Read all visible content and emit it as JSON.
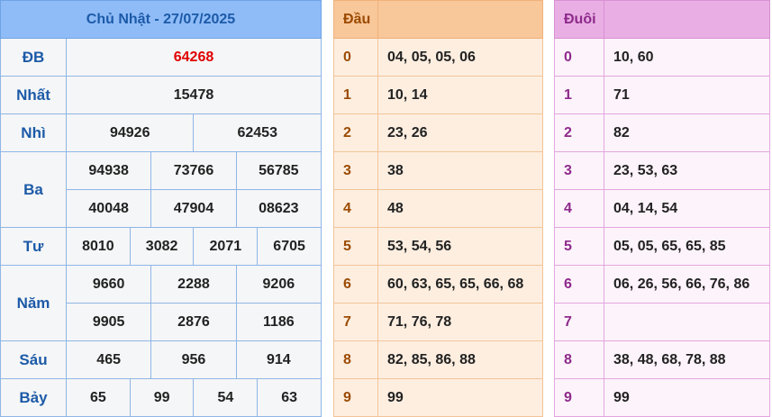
{
  "results": {
    "header": "Chủ Nhật - 27/07/2025",
    "db": {
      "label": "ĐB",
      "value": "64268"
    },
    "nhat": {
      "label": "Nhất",
      "value": "15478"
    },
    "nhi": {
      "label": "Nhì",
      "values": [
        "94926",
        "62453"
      ]
    },
    "ba": {
      "label": "Ba",
      "row1": [
        "94938",
        "73766",
        "56785"
      ],
      "row2": [
        "40048",
        "47904",
        "08623"
      ]
    },
    "tu": {
      "label": "Tư",
      "values": [
        "8010",
        "3082",
        "2071",
        "6705"
      ]
    },
    "nam": {
      "label": "Năm",
      "row1": [
        "9660",
        "2288",
        "9206"
      ],
      "row2": [
        "9905",
        "2876",
        "1186"
      ]
    },
    "sau": {
      "label": "Sáu",
      "values": [
        "465",
        "956",
        "914"
      ]
    },
    "bay": {
      "label": "Bảy",
      "values": [
        "65",
        "99",
        "54",
        "63"
      ]
    }
  },
  "dau": {
    "header": "Đầu",
    "rows": [
      {
        "key": "0",
        "value": "04, 05, 05, 06"
      },
      {
        "key": "1",
        "value": "10, 14"
      },
      {
        "key": "2",
        "value": "23, 26"
      },
      {
        "key": "3",
        "value": "38"
      },
      {
        "key": "4",
        "value": "48"
      },
      {
        "key": "5",
        "value": "53, 54, 56"
      },
      {
        "key": "6",
        "value": "60, 63, 65, 65, 66, 68"
      },
      {
        "key": "7",
        "value": "71, 76, 78"
      },
      {
        "key": "8",
        "value": "82, 85, 86, 88"
      },
      {
        "key": "9",
        "value": "99"
      }
    ]
  },
  "duoi": {
    "header": "Đuôi",
    "rows": [
      {
        "key": "0",
        "value": "10, 60"
      },
      {
        "key": "1",
        "value": "71"
      },
      {
        "key": "2",
        "value": "82"
      },
      {
        "key": "3",
        "value": "23, 53, 63"
      },
      {
        "key": "4",
        "value": "04, 14, 54"
      },
      {
        "key": "5",
        "value": "05, 05, 65, 65, 85"
      },
      {
        "key": "6",
        "value": "06, 26, 56, 66, 76, 86"
      },
      {
        "key": "7",
        "value": ""
      },
      {
        "key": "8",
        "value": "38, 48, 68, 78, 88"
      },
      {
        "key": "9",
        "value": "99"
      }
    ]
  },
  "colors": {
    "results_header_bg": "#8fbcf7",
    "special_prize": "#e00000",
    "dau_header_bg": "#f8c79a",
    "duoi_header_bg": "#e9afe4"
  }
}
